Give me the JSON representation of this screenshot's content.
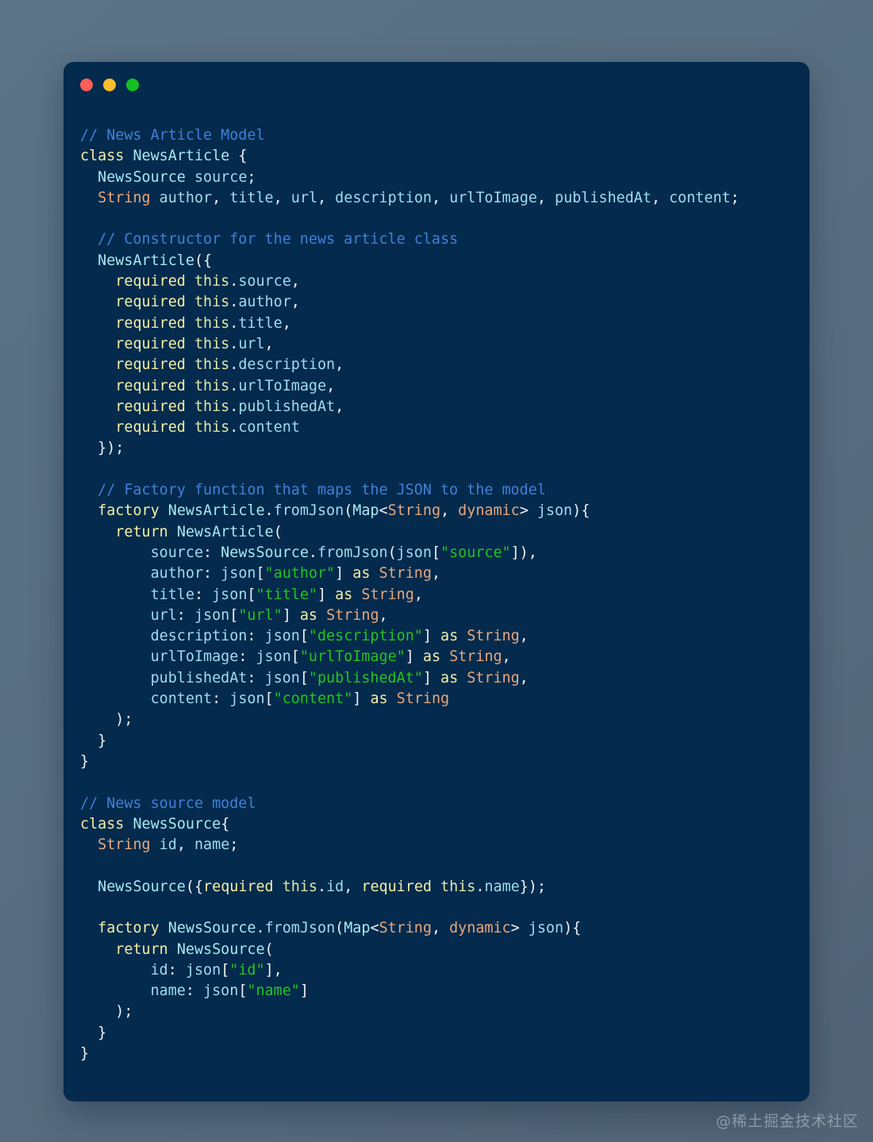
{
  "window": {
    "title": "Code Snippet",
    "controls": [
      {
        "name": "close",
        "label": "",
        "color": "#ff5f57"
      },
      {
        "name": "minimize",
        "label": "",
        "color": "#febc2e"
      },
      {
        "name": "maximize",
        "label": "",
        "color": "#14c024"
      }
    ],
    "background_color": "#042a4d",
    "page_background_color": "#5c7488"
  },
  "theme": {
    "comment": "#3f81d8",
    "keyword": "#f2f0a5",
    "type": "#e8a87c",
    "class": "#a5e9f2",
    "identifier": "#9fdcef",
    "string": "#23c422",
    "punctuation": "#f0f4f6",
    "default_text": "#cfeaf5"
  },
  "code": {
    "language": "dart",
    "lines": [
      "// News Article Model",
      "class NewsArticle {",
      "  NewsSource source;",
      "  String author, title, url, description, urlToImage, publishedAt, content;",
      "",
      "  // Constructor for the news article class",
      "  NewsArticle({",
      "    required this.source,",
      "    required this.author,",
      "    required this.title,",
      "    required this.url,",
      "    required this.description,",
      "    required this.urlToImage,",
      "    required this.publishedAt,",
      "    required this.content",
      "  });",
      "",
      "  // Factory function that maps the JSON to the model",
      "  factory NewsArticle.fromJson(Map<String, dynamic> json){",
      "    return NewsArticle(",
      "        source: NewsSource.fromJson(json[\"source\"]),",
      "        author: json[\"author\"] as String,",
      "        title: json[\"title\"] as String,",
      "        url: json[\"url\"] as String,",
      "        description: json[\"description\"] as String,",
      "        urlToImage: json[\"urlToImage\"] as String,",
      "        publishedAt: json[\"publishedAt\"] as String,",
      "        content: json[\"content\"] as String",
      "    );",
      "  }",
      "}",
      "",
      "// News source model",
      "class NewsSource{",
      "  String id, name;",
      "",
      "  NewsSource({required this.id, required this.name});",
      "",
      "  factory NewsSource.fromJson(Map<String, dynamic> json){",
      "    return NewsSource(",
      "        id: json[\"id\"],",
      "        name: json[\"name\"]",
      "    );",
      "  }",
      "}"
    ]
  },
  "watermark": {
    "text": "@稀土掘金技术社区"
  }
}
